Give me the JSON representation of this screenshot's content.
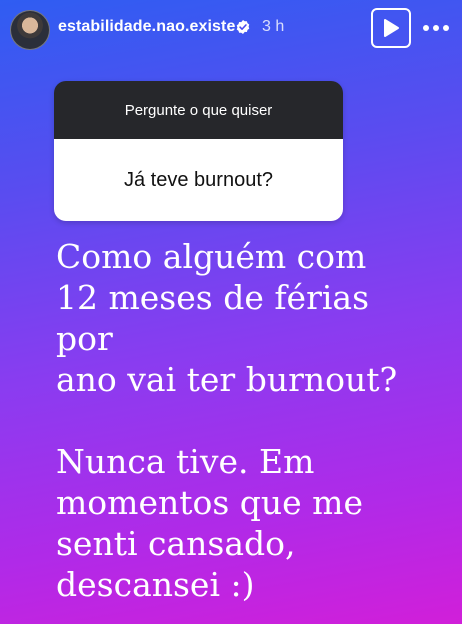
{
  "header": {
    "username": "estabilidade.nao.existe",
    "time": "3 h",
    "verified_icon": "verified-badge-icon",
    "play_icon": "play-icon",
    "more_icon": "more-options-icon"
  },
  "question": {
    "header": "Pergunte o que quiser",
    "text": "Já teve burnout?"
  },
  "answer": {
    "lines_1": [
      "Como alguém com",
      "12 meses de férias por",
      "ano vai ter burnout?"
    ],
    "lines_2": [
      "Nunca tive. Em",
      "momentos que me",
      "senti cansado,",
      "descansei :)"
    ]
  },
  "colors": {
    "gradient_top": "#2f5df2",
    "gradient_bottom": "#d11fd9",
    "question_header_bg": "#26272b"
  }
}
